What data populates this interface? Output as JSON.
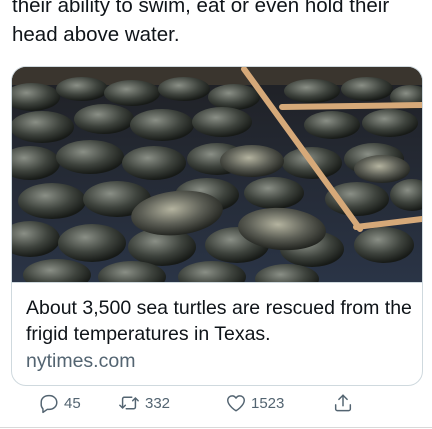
{
  "tweet": {
    "text": "their ability to swim, eat or even hold their\nhead above water."
  },
  "card": {
    "image_alt": "Hundreds of cold-stunned sea turtles lying on a floor",
    "title": "About 3,500 sea turtles are rescued from the frigid temperatures in Texas.",
    "domain": "nytimes.com"
  },
  "actions": {
    "reply_count": "45",
    "retweet_count": "332",
    "like_count": "1523"
  },
  "icons": {
    "reply": "reply-icon",
    "retweet": "retweet-icon",
    "like": "heart-icon",
    "share": "share-icon"
  },
  "colors": {
    "text": "#0f1419",
    "secondary": "#536471",
    "border": "#cfd9de"
  }
}
